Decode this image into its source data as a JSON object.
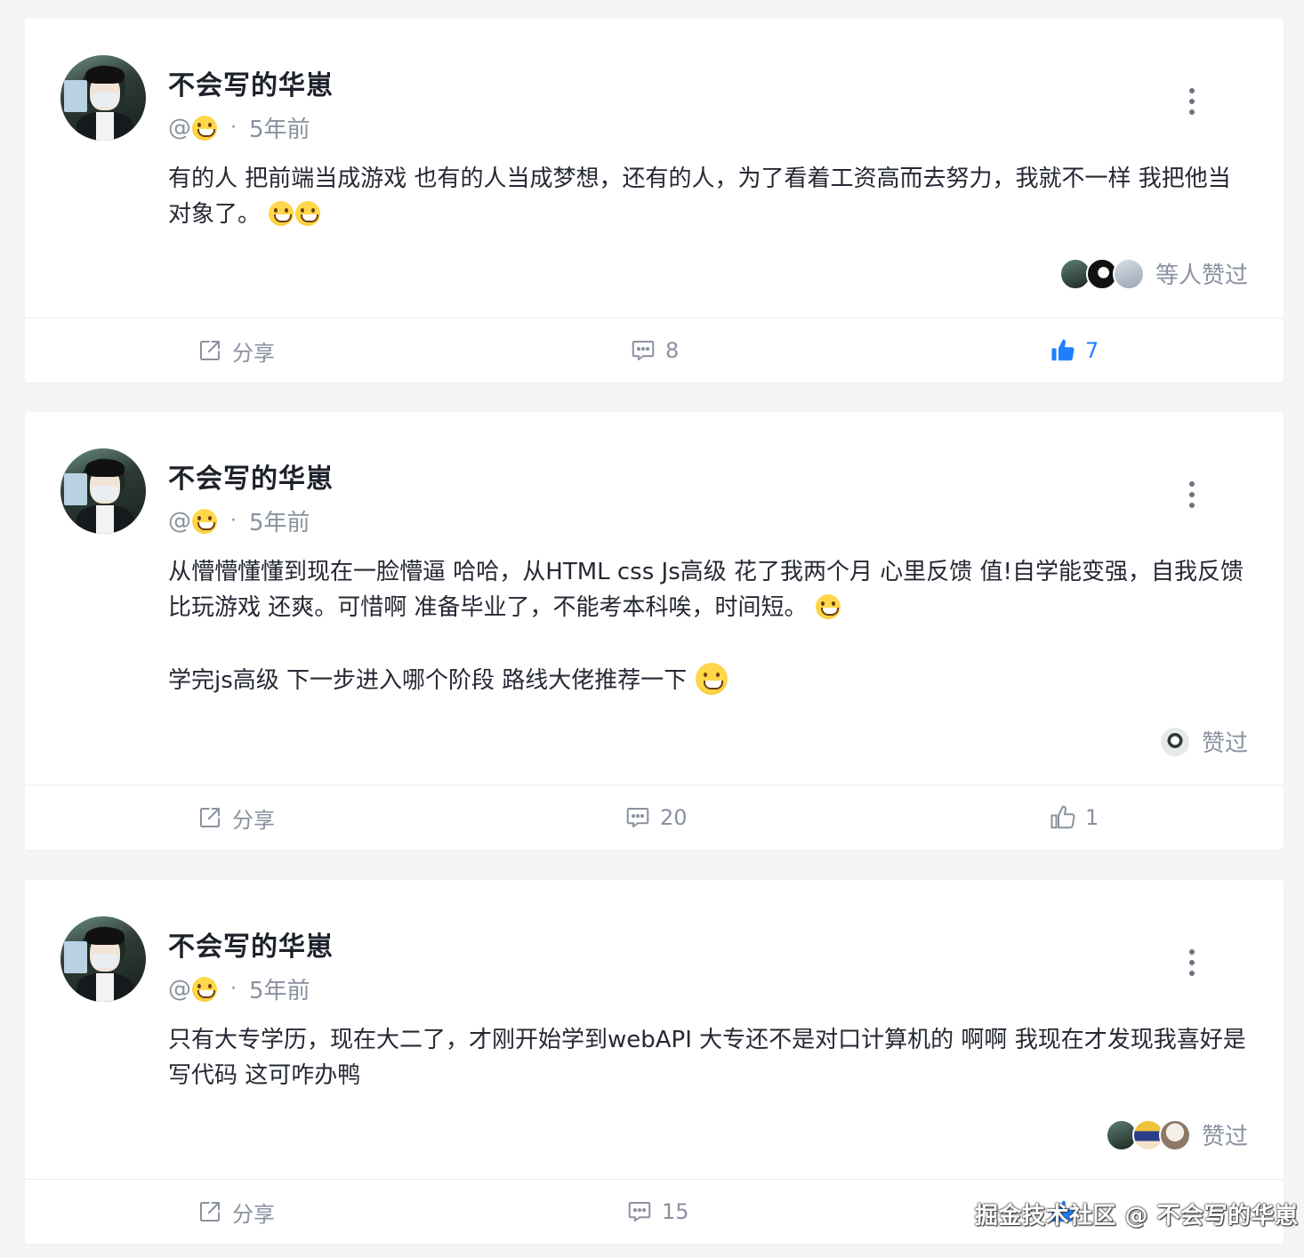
{
  "posts": [
    {
      "author": "不会写的华崽",
      "handle": "@",
      "time": "5年前",
      "content": [
        "有的人 把前端当成游戏 也有的人当成梦想，还有的人，为了看着工资高而去努力，我就不一样 我把他当对象了。"
      ],
      "likers_text": "等人赞过",
      "share_label": "分享",
      "comments": "8",
      "likes": "7",
      "liked": true
    },
    {
      "author": "不会写的华崽",
      "handle": "@",
      "time": "5年前",
      "content": [
        "从懵懵懂懂到现在一脸懵逼 哈哈，从HTML css Js高级 花了我两个月 心里反馈 值!自学能变强，自我反馈比玩游戏 还爽。可惜啊 准备毕业了，不能考本科唉，时间短。",
        "学完js高级 下一步进入哪个阶段 路线大佬推荐一下"
      ],
      "likers_text": "赞过",
      "share_label": "分享",
      "comments": "20",
      "likes": "1",
      "liked": false
    },
    {
      "author": "不会写的华崽",
      "handle": "@",
      "time": "5年前",
      "content": [
        "只有大专学历，现在大二了，才刚开始学到webAPI 大专还不是对口计算机的 啊啊 我现在才发现我喜好是写代码 这可咋办鸭"
      ],
      "likers_text": "赞过",
      "share_label": "分享",
      "comments": "15",
      "likes": "",
      "liked": false
    }
  ],
  "watermark": "掘金技术社区 @ 不会写的华崽",
  "colors": {
    "accent": "#1e80ff",
    "muted": "#8a919f",
    "text": "#252933"
  },
  "icons": [
    "share-icon",
    "comment-icon",
    "thumbs-up-icon",
    "more-vertical-icon",
    "grinning-emoji",
    "winking-emoji"
  ]
}
